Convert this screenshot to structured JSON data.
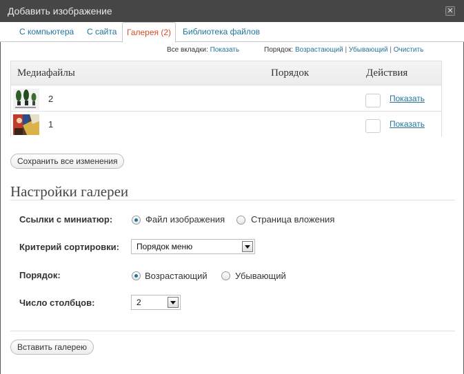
{
  "window": {
    "title": "Добавить изображение"
  },
  "tabs": [
    {
      "label": "С компьютера",
      "active": false
    },
    {
      "label": "С сайта",
      "active": false
    },
    {
      "label": "Галерея (2)",
      "active": true
    },
    {
      "label": "Библиотека файлов",
      "active": false
    }
  ],
  "toolbar": {
    "all_tabs_label": "Все вкладки:",
    "all_tabs_show": "Показать",
    "order_label": "Порядок:",
    "ascending": "Возрастающий",
    "descending": "Убывающий",
    "clear": "Очистить",
    "separator": "|"
  },
  "media_table": {
    "headers": {
      "media": "Медиафайлы",
      "order": "Порядок",
      "actions": "Действия"
    },
    "rows": [
      {
        "order": "2",
        "action": "Показать",
        "thumb_icon": "bonsai-trees-thumbnail"
      },
      {
        "order": "1",
        "action": "Показать",
        "thumb_icon": "painting-thumbnail"
      }
    ]
  },
  "save_all_button": "Сохранить все изменения",
  "gallery_settings": {
    "title": "Настройки галереи",
    "thumbnail_links": {
      "label": "Ссылки с миниатюр:",
      "options": [
        "Файл изображения",
        "Страница вложения"
      ],
      "selected": "Файл изображения"
    },
    "sort_criteria": {
      "label": "Критерий сортировки:",
      "value": "Порядок меню"
    },
    "order": {
      "label": "Порядок:",
      "options": [
        "Возрастающий",
        "Убывающий"
      ],
      "selected": "Возрастающий"
    },
    "columns": {
      "label": "Число столбцов:",
      "value": "2"
    }
  },
  "insert_gallery_button": "Вставить галерею",
  "colors": {
    "link": "#21759b",
    "active_tab": "#d54e21",
    "titlebar": "#464646"
  }
}
